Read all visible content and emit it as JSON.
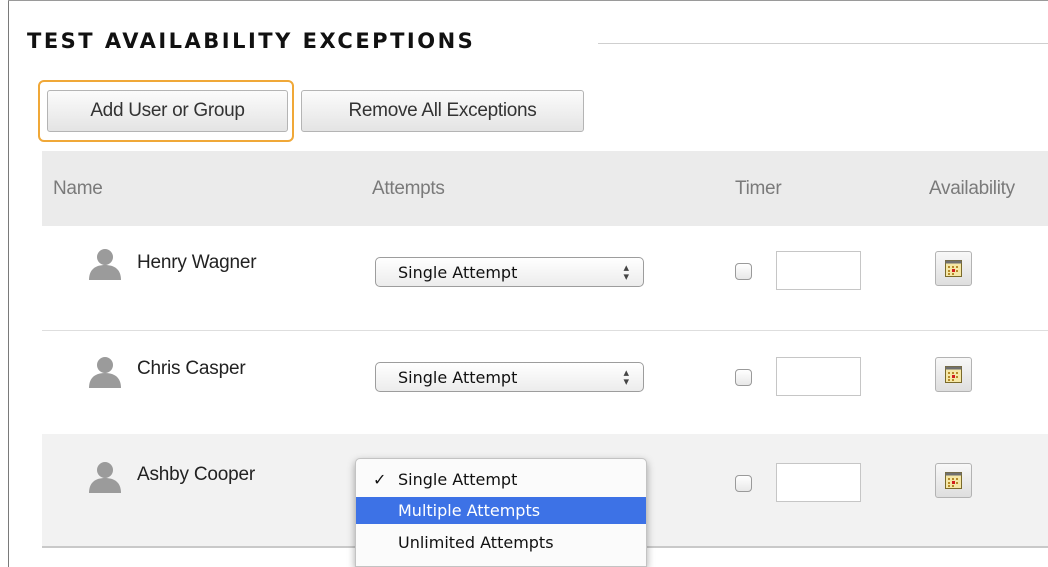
{
  "section": {
    "title": "TEST AVAILABILITY EXCEPTIONS"
  },
  "toolbar": {
    "add_label": "Add User or Group",
    "remove_label": "Remove All Exceptions"
  },
  "table": {
    "headers": {
      "name": "Name",
      "attempts": "Attempts",
      "timer": "Timer",
      "availability": "Availability"
    },
    "rows": [
      {
        "name": "Henry Wagner",
        "attempts": "Single Attempt",
        "timer_enabled": false,
        "timer_value": ""
      },
      {
        "name": "Chris Casper",
        "attempts": "Single Attempt",
        "timer_enabled": false,
        "timer_value": ""
      },
      {
        "name": "Ashby Cooper",
        "attempts": "Single Attempt",
        "timer_enabled": false,
        "timer_value": ""
      }
    ]
  },
  "attempts_dropdown": {
    "options": [
      "Single Attempt",
      "Multiple Attempts",
      "Unlimited Attempts"
    ],
    "selected": "Single Attempt",
    "highlighted": "Multiple Attempts",
    "check_mark": "✓"
  },
  "icons": {
    "person": "person-icon",
    "calendar": "calendar-icon",
    "select_arrows": "updown-arrows-icon"
  },
  "colors": {
    "focus_ring": "#f0a838",
    "highlight": "#3d72e6",
    "header_bg": "#ebebeb",
    "alt_row_bg": "#f2f2f2"
  }
}
